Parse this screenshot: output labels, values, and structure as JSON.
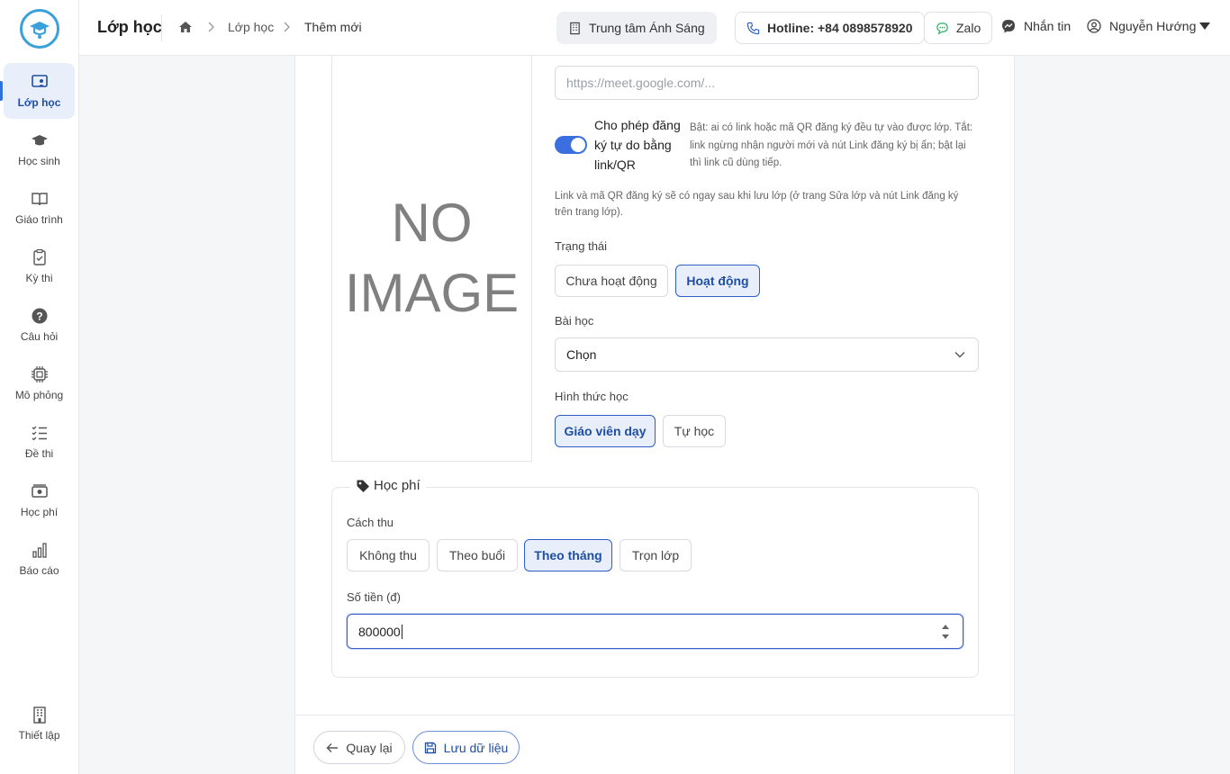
{
  "app": {
    "page_title": "Lớp học",
    "breadcrumb": [
      "Lớp học",
      "Thêm mới"
    ]
  },
  "sidebar": {
    "items": [
      {
        "label": "Lớp học",
        "icon": "classroom-icon",
        "active": true
      },
      {
        "label": "Học sinh",
        "icon": "graduation-cap-icon"
      },
      {
        "label": "Giáo trình",
        "icon": "book-icon"
      },
      {
        "label": "Kỳ thi",
        "icon": "clipboard-check-icon"
      },
      {
        "label": "Câu hỏi",
        "icon": "question-circle-icon"
      },
      {
        "label": "Mô phỏng",
        "icon": "chip-icon"
      },
      {
        "label": "Đề thi",
        "icon": "checklist-icon"
      },
      {
        "label": "Học phí",
        "icon": "money-icon"
      },
      {
        "label": "Báo cáo",
        "icon": "bar-chart-icon"
      }
    ],
    "settings_label": "Thiết lập"
  },
  "header": {
    "center_name": "Trung tâm Ánh Sáng",
    "hotline": "Hotline: +84 0898578920",
    "zalo": "Zalo",
    "message": "Nhắn tin",
    "user": "Nguyễn Hướng"
  },
  "form": {
    "no_image_line1": "NO",
    "no_image_line2": "IMAGE",
    "meeting_link_placeholder": "https://meet.google.com/...",
    "self_register_label": "Cho phép đăng ký tự do bằng link/QR",
    "self_register_help": "Bật: ai có link hoặc mã QR đăng ký đều tự vào được lớp. Tắt: link ngừng nhận người mới và nút Link đăng ký bị ẩn; bật lại thì link cũ dùng tiếp.",
    "self_register_enabled": true,
    "note": "Link và mã QR đăng ký sẽ có ngay sau khi lưu lớp (ở trang Sửa lớp và nút Link đăng ký trên trang lớp).",
    "status_label": "Trạng thái",
    "status_options": [
      "Chưa hoạt động",
      "Hoạt động"
    ],
    "status_selected": "Hoạt động",
    "lesson_label": "Bài học",
    "lesson_value": "Chọn",
    "mode_label": "Hình thức học",
    "mode_options": [
      "Giáo viên dạy",
      "Tự học"
    ],
    "mode_selected": "Giáo viên dạy"
  },
  "fee": {
    "legend": "Học phí",
    "method_label": "Cách thu",
    "method_options": [
      "Không thu",
      "Theo buổi",
      "Theo tháng",
      "Trọn lớp"
    ],
    "method_selected": "Theo tháng",
    "amount_label": "Số tiền (đ)",
    "amount_value": "800000"
  },
  "footer": {
    "back_label": "Quay lại",
    "save_label": "Lưu dữ liệu"
  },
  "colors": {
    "accent": "#2f5fc4",
    "accent_bg": "#e8effb",
    "toggle_on": "#3b6fe0"
  }
}
